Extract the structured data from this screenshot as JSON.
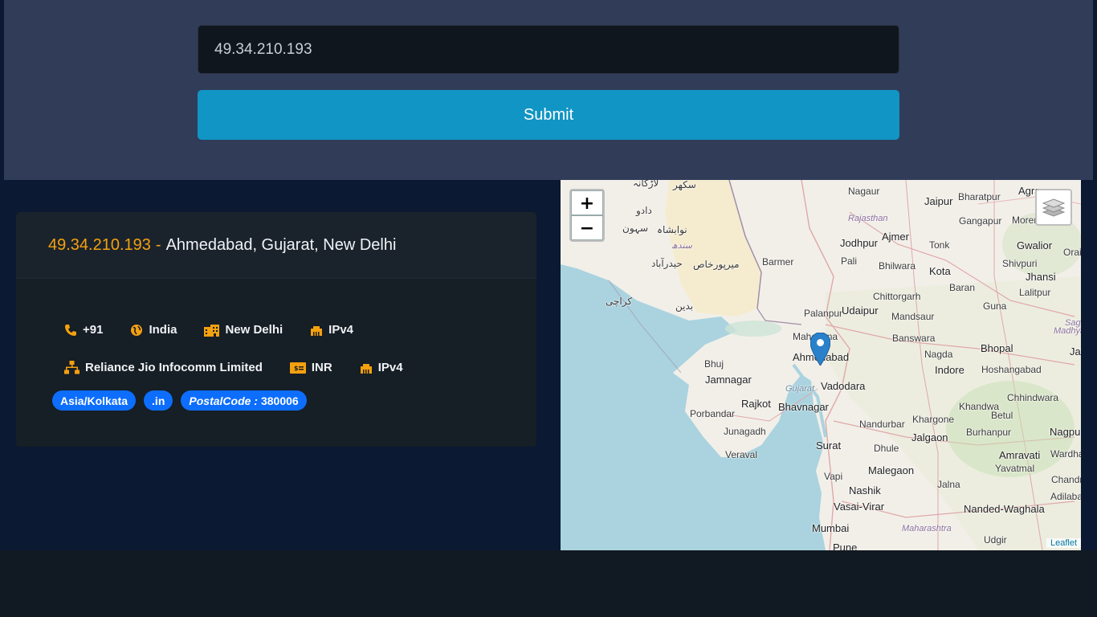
{
  "search": {
    "ip_value": "49.34.210.193",
    "submit_label": "Submit"
  },
  "result": {
    "ip": "49.34.210.193",
    "separator": "-",
    "location": "Ahmedabad, Gujarat, New Delhi",
    "phone_code": "+91",
    "country": "India",
    "city": "New Delhi",
    "ip_version": "IPv4",
    "isp": "Reliance Jio Infocomm Limited",
    "currency": "INR",
    "ip_version_2": "IPv4",
    "timezone": "Asia/Kolkata",
    "tld": ".in",
    "postal_key": "PostalCode :",
    "postal_code": "380006"
  },
  "map": {
    "zoom_in": "+",
    "zoom_out": "−",
    "attribution": "Leaflet",
    "labels": {
      "larkana": "لاڑکانہ",
      "sukkur": "سکھر",
      "dadu": "دادو",
      "nawabshah": "نوابشاہ",
      "sehwan": "سہون",
      "sindh": "سندھ",
      "hyderabad_pk": "حیدرآباد",
      "mirpurkhas": "میرپورخاص",
      "karachi": "کراچی",
      "badin": "بدین",
      "nagaur": "Nagaur",
      "jaipur": "Jaipur",
      "bharatpur": "Bharatpur",
      "agra": "Agra",
      "rajasthan": "Rajasthan",
      "gangapur": "Gangapur",
      "morena": "Morena",
      "jodhpur": "Jodhpur",
      "ajmer": "Ajmer",
      "tonk": "Tonk",
      "gwalior": "Gwalior",
      "barmer": "Barmer",
      "pali": "Pali",
      "bhilwara": "Bhilwara",
      "shivpuri": "Shivpuri",
      "orai": "Orai",
      "kota": "Kota",
      "jhansi": "Jhansi",
      "chittorgarh": "Chittorgarh",
      "baran": "Baran",
      "lalitpur": "Lalitpur",
      "palanpur": "Palanpur",
      "udaipur": "Udaipur",
      "mandsaur": "Mandsaur",
      "guna": "Guna",
      "mahesana": "Mahesana",
      "sagar": "Sagar",
      "madhya": "Madhya Prades",
      "banswara": "Banswara",
      "ahmedabad": "Ahmedabad",
      "nagda": "Nagda",
      "bhopal": "Bhopal",
      "jab": "Jab",
      "bhuj": "Bhuj",
      "jamnagar": "Jamnagar",
      "indore": "Indore",
      "hoshangabad": "Hoshangabad",
      "gujarat": "Gujarat",
      "vadodara": "Vadodara",
      "rajkot": "Rajkot",
      "bhavnagar": "Bhavnagar",
      "chhindwara": "Chhindwara",
      "khandwa": "Khandwa",
      "porbandar": "Porbandar",
      "nandurbar": "Nandurbar",
      "khargone": "Khargone",
      "betul": "Betul",
      "junagadh": "Junagadh",
      "surat": "Surat",
      "jalgaon": "Jalgaon",
      "burhanpur": "Burhanpur",
      "nagpur": "Nagpur",
      "dhule": "Dhule",
      "amravati": "Amravati",
      "wardha": "Wardha",
      "veraval": "Veraval",
      "yavatmal": "Yavatmal",
      "malegaon": "Malegaon",
      "chandrapur": "Chandrapur",
      "vapi": "Vapi",
      "nashik": "Nashik",
      "jalna": "Jalna",
      "adilabad": "Adilabad",
      "vasai": "Vasai-Virar",
      "nanded": "Nanded-Waghala",
      "mumbai": "Mumbai",
      "maharashtra": "Maharashtra",
      "udgir": "Udgir",
      "pune": "Pune"
    }
  },
  "colors": {
    "accent": "#f5a00f",
    "submit": "#1195c4",
    "badge": "#0d6efd",
    "panel": "#313c59",
    "page": "#0b1932"
  }
}
